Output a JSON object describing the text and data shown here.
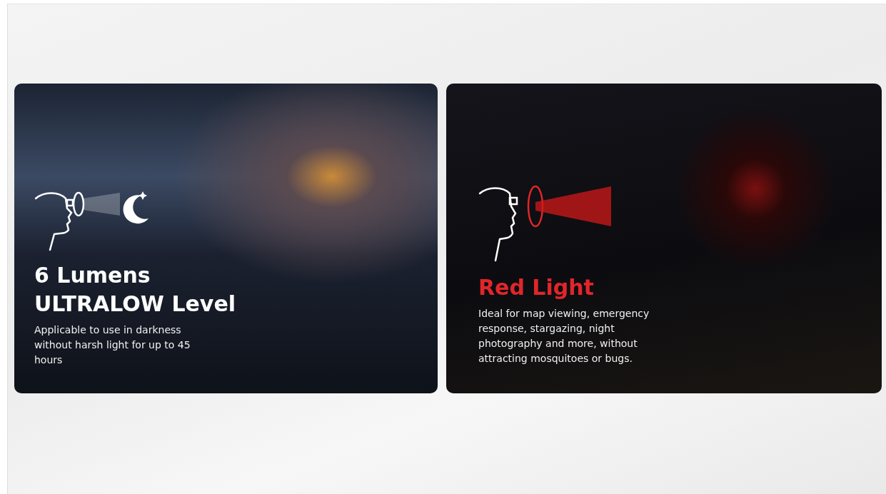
{
  "cards": [
    {
      "kind": "white",
      "title_lines": [
        "6 Lumens",
        "ULTRALOW Level"
      ],
      "description": "Applicable to use in darkness without harsh light for up to 45 hours"
    },
    {
      "kind": "red",
      "title_lines": [
        "Red Light"
      ],
      "description": "Ideal for map viewing, emergency response, stargazing, night photography and more, without attracting mosquitoes or bugs."
    }
  ]
}
